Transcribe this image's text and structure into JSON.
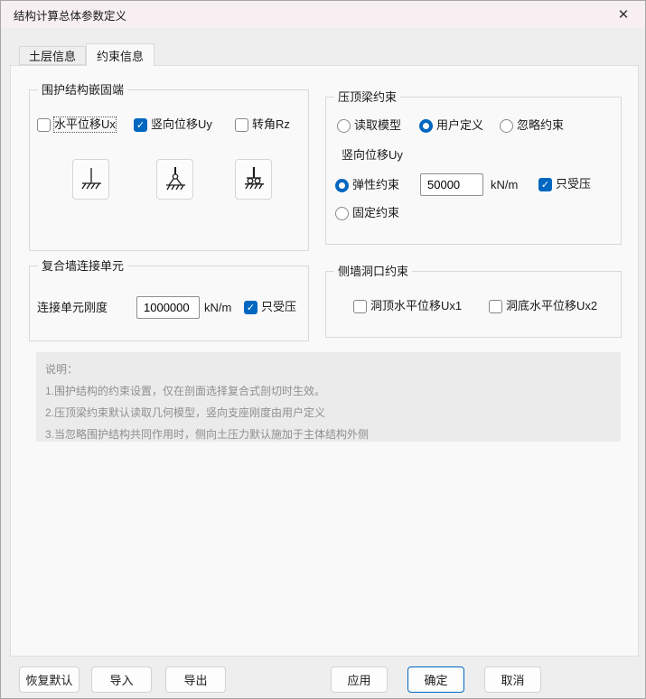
{
  "window": {
    "title": "结构计算总体参数定义"
  },
  "icons": {
    "close_glyph": "✕",
    "check_glyph": "✓"
  },
  "tabs": [
    {
      "label": "土层信息",
      "selected": false
    },
    {
      "label": "约束信息",
      "selected": true
    }
  ],
  "groups": {
    "embed": {
      "title": "围护结构嵌固端",
      "checkboxes": [
        {
          "label": "水平位移Ux",
          "checked": false,
          "focused": true
        },
        {
          "label": "竖向位移Uy",
          "checked": true
        },
        {
          "label": "转角Rz",
          "checked": false
        }
      ],
      "support_icons": [
        "fixed-support",
        "pinned-support",
        "roller-support"
      ]
    },
    "cap_beam": {
      "title": "压顶梁约束",
      "radios": [
        {
          "label": "读取模型",
          "selected": false
        },
        {
          "label": "用户定义",
          "selected": true
        },
        {
          "label": "忽略约束",
          "selected": false
        }
      ],
      "sub_label": "竖向位移Uy",
      "elastic": {
        "label": "弹性约束",
        "selected": true,
        "value": "50000",
        "unit": "kN/m",
        "compression_label": "只受压",
        "compression_checked": true
      },
      "fixed": {
        "label": "固定约束",
        "selected": false
      }
    },
    "composite_wall": {
      "title": "复合墙连接单元",
      "stiffness_label": "连接单元刚度",
      "value": "1000000",
      "unit": "kN/m",
      "compression_label": "只受压",
      "compression_checked": true
    },
    "side_wall": {
      "title": "侧墙洞口约束",
      "checkboxes": [
        {
          "label": "洞顶水平位移Ux1",
          "checked": false
        },
        {
          "label": "洞底水平位移Ux2",
          "checked": false
        }
      ]
    }
  },
  "notes": {
    "title": "说明：",
    "lines": [
      "1.围护结构的约束设置，仅在剖面选择复合式剖切时生效。",
      "2.压顶梁约束默认读取几何模型，竖向支座刚度由用户定义",
      "3.当忽略围护结构共同作用时，侧向土压力默认施加于主体结构外侧"
    ]
  },
  "footer": {
    "restore_label": "恢复默认",
    "import_label": "导入",
    "export_label": "导出",
    "apply_label": "应用",
    "ok_label": "确定",
    "cancel_label": "取消"
  },
  "colors": {
    "accent": "#0067c0",
    "titlebar": "#f7eff2",
    "panel": "#f9f9f9",
    "notes_bg": "#ebebeb"
  }
}
